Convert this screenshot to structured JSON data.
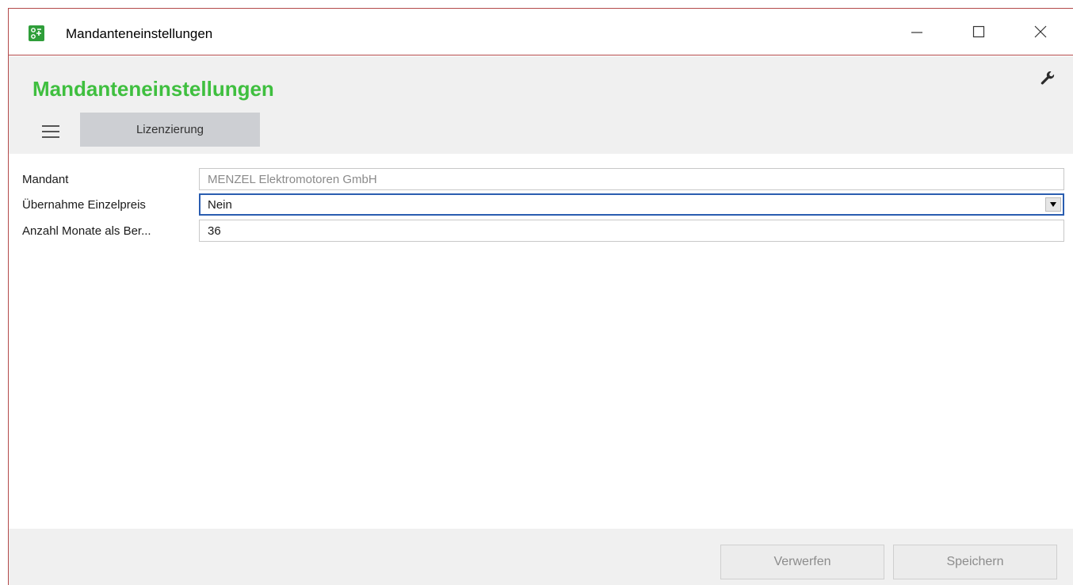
{
  "window": {
    "title": "Mandanteneinstellungen",
    "controls": {
      "minimize": "minimize-icon",
      "maximize": "maximize-icon",
      "close": "close-icon"
    }
  },
  "header": {
    "page_title": "Mandanteneinstellungen",
    "title_color": "#3fbf3f",
    "settings_icon": "wrench-icon",
    "menu_icon": "hamburger-menu-icon",
    "tabs": [
      {
        "label": "Lizenzierung"
      }
    ]
  },
  "form": {
    "fields": [
      {
        "label": "Mandant",
        "value": "MENZEL Elektromotoren GmbH",
        "readonly": true
      },
      {
        "label": "Übernahme Einzelpreis",
        "value": "Nein",
        "type": "select"
      },
      {
        "label": "Anzahl Monate als Ber...",
        "value": "36"
      }
    ]
  },
  "footer": {
    "discard_label": "Verwerfen",
    "save_label": "Speichern"
  },
  "colors": {
    "accent_green": "#3fbf3f",
    "focus_border": "#2a5db0",
    "window_border": "#b34a4a"
  }
}
